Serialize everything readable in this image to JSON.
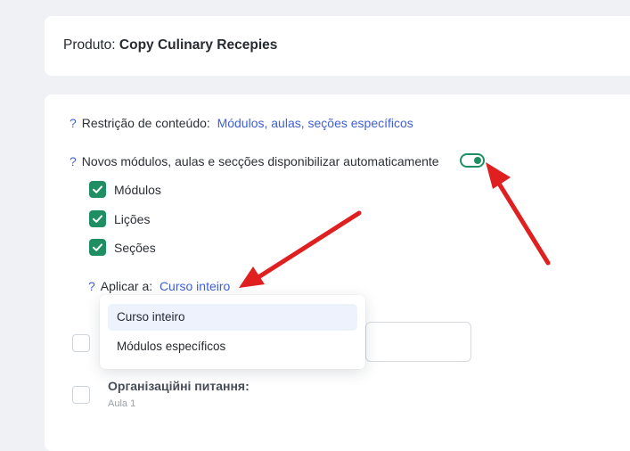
{
  "product": {
    "label": "Produto:",
    "name": "Copy Culinary Recepies"
  },
  "settings": {
    "restriction": {
      "help_icon": "?",
      "label": "Restrição de conteúdo:",
      "value": "Módulos, aulas, seções específicos"
    },
    "auto_release": {
      "help_icon": "?",
      "label": "Novos módulos, aulas e secções disponibilizar automaticamente",
      "toggle_on": true
    },
    "checkboxes": [
      {
        "label": "Módulos",
        "checked": true
      },
      {
        "label": "Lições",
        "checked": true
      },
      {
        "label": "Seções",
        "checked": true
      }
    ],
    "apply_to": {
      "help_icon": "?",
      "label": "Aplicar a:",
      "value": "Curso inteiro"
    }
  },
  "dropdown": {
    "options": [
      {
        "label": "Curso inteiro",
        "selected": true
      },
      {
        "label": "Módulos específicos",
        "selected": false
      }
    ]
  },
  "lesson": {
    "title": "Організаційні питання:",
    "subtitle": "Aula 1"
  },
  "colors": {
    "accent": "#3f5fd6",
    "green": "#1f8f63",
    "arrow": "#e02020"
  }
}
